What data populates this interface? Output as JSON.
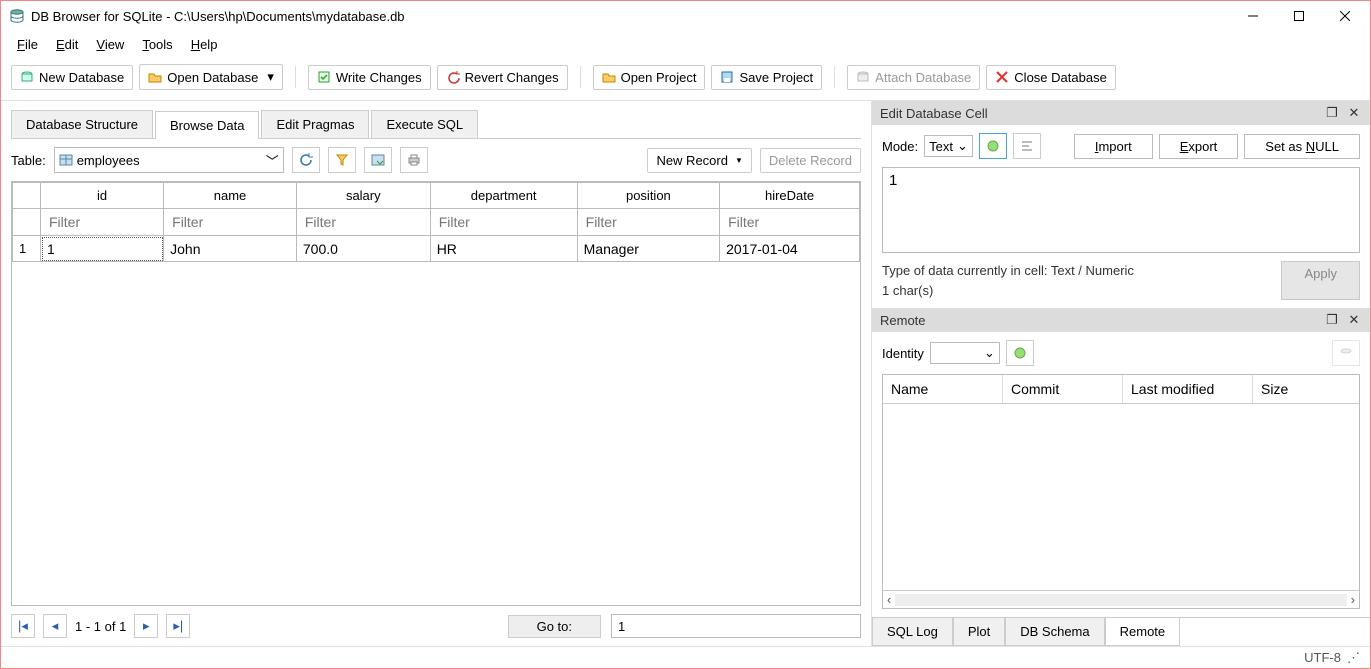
{
  "window": {
    "title": "DB Browser for SQLite - C:\\Users\\hp\\Documents\\mydatabase.db"
  },
  "menu": {
    "file": "File",
    "edit": "Edit",
    "view": "View",
    "tools": "Tools",
    "help": "Help"
  },
  "toolbar": {
    "new_db": "New Database",
    "open_db": "Open Database",
    "write_changes": "Write Changes",
    "revert_changes": "Revert Changes",
    "open_project": "Open Project",
    "save_project": "Save Project",
    "attach_db": "Attach Database",
    "close_db": "Close Database"
  },
  "main_tabs": {
    "structure": "Database Structure",
    "browse": "Browse Data",
    "pragmas": "Edit Pragmas",
    "sql": "Execute SQL"
  },
  "browse": {
    "table_label": "Table:",
    "table_selected": "employees",
    "new_record": "New Record",
    "delete_record": "Delete Record",
    "columns": [
      "id",
      "name",
      "salary",
      "department",
      "position",
      "hireDate"
    ],
    "filter_placeholder": "Filter",
    "rows": [
      {
        "num": "1",
        "cells": [
          "1",
          "John",
          "700.0",
          "HR",
          "Manager",
          "2017-01-04"
        ]
      }
    ],
    "pager_text": "1 - 1 of 1",
    "goto_label": "Go to:",
    "goto_value": "1"
  },
  "edit_cell": {
    "title": "Edit Database Cell",
    "mode_label": "Mode:",
    "mode_value": "Text",
    "import": "Import",
    "export": "Export",
    "set_null": "Set as NULL",
    "cell_value": "1",
    "type_line": "Type of data currently in cell: Text / Numeric",
    "char_line": "1 char(s)",
    "apply": "Apply"
  },
  "remote": {
    "title": "Remote",
    "identity_label": "Identity",
    "cols": {
      "name": "Name",
      "commit": "Commit",
      "lastmod": "Last modified",
      "size": "Size"
    }
  },
  "bottom_tabs": {
    "sql_log": "SQL Log",
    "plot": "Plot",
    "schema": "DB Schema",
    "remote": "Remote"
  },
  "status": {
    "encoding": "UTF-8"
  }
}
